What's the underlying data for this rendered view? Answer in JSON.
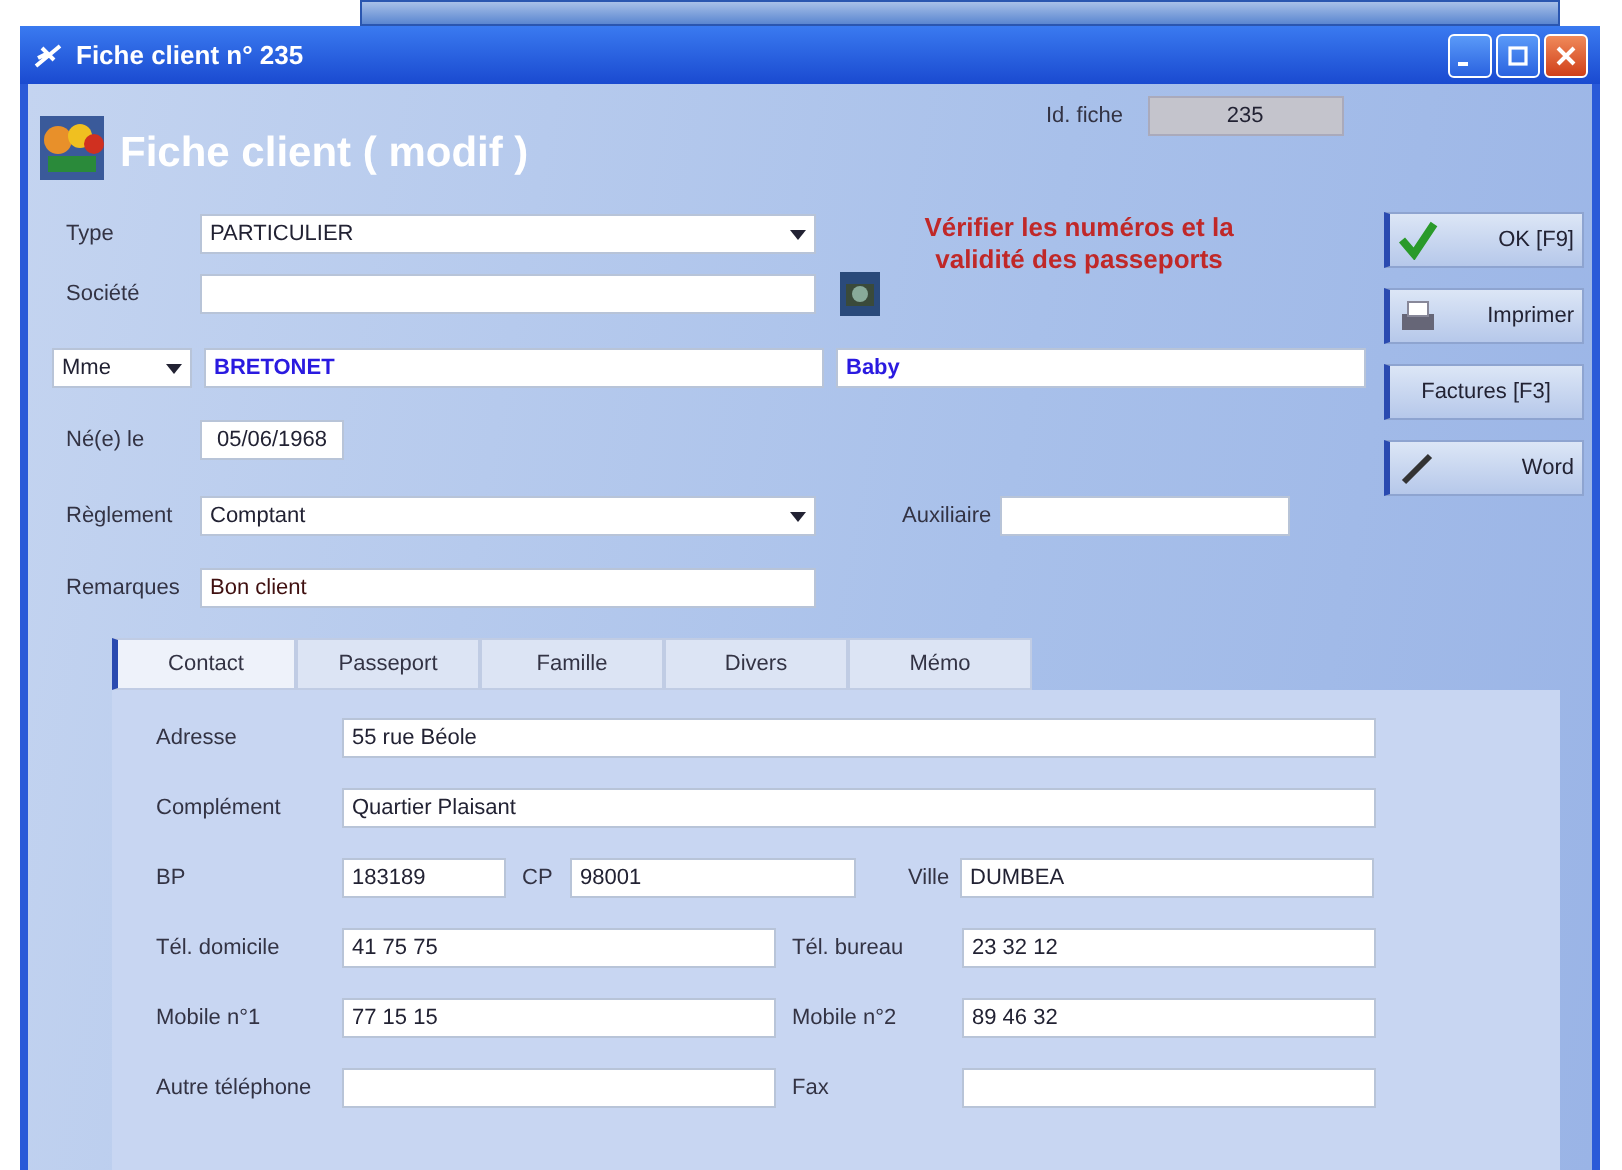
{
  "window": {
    "title": "Fiche client n° 235"
  },
  "header": {
    "title": "Fiche client ( modif )",
    "id_label": "Id. fiche",
    "id_value": "235"
  },
  "warning": "Vérifier les numéros et la validité des passeports",
  "form": {
    "type_label": "Type",
    "type_value": "PARTICULIER",
    "societe_label": "Société",
    "civilite": "Mme",
    "nom": "BRETONET",
    "prenom": "Baby",
    "naissance_label": "Né(e) le",
    "naissance": "05/06/1968",
    "reglement_label": "Règlement",
    "reglement": "Comptant",
    "auxiliaire_label": "Auxiliaire",
    "remarques_label": "Remarques",
    "remarques": "Bon client"
  },
  "buttons": [
    {
      "label": "OK [F9]"
    },
    {
      "label": "Imprimer"
    },
    {
      "label": "Factures [F3]"
    },
    {
      "label": "Word"
    }
  ],
  "tabs": [
    {
      "label": "Contact",
      "selected": true
    },
    {
      "label": "Passeport",
      "selected": false
    },
    {
      "label": "Famille",
      "selected": false
    },
    {
      "label": "Divers",
      "selected": false
    },
    {
      "label": "Mémo",
      "selected": false
    }
  ],
  "contact": [
    {
      "kind": "wide",
      "cells": [
        {
          "label": "Adresse",
          "value": "55 rue Béole"
        }
      ]
    },
    {
      "kind": "wide",
      "cells": [
        {
          "label": "Complément",
          "value": "Quartier Plaisant"
        }
      ]
    },
    {
      "kind": "triple",
      "cells": [
        {
          "label": "BP",
          "value": "183189"
        },
        {
          "label": "CP",
          "value": "98001"
        },
        {
          "label": "Ville",
          "value": "DUMBEA"
        }
      ]
    },
    {
      "kind": "pair",
      "cells": [
        {
          "label": "Tél. domicile",
          "value": "41 75 75"
        },
        {
          "label": "Tél. bureau",
          "value": "23 32 12"
        }
      ]
    },
    {
      "kind": "pair",
      "cells": [
        {
          "label": "Mobile n°1",
          "value": "77 15 15"
        },
        {
          "label": "Mobile n°2",
          "value": "89 46 32"
        }
      ]
    },
    {
      "kind": "pair",
      "cells": [
        {
          "label": "Autre téléphone"
        },
        {
          "label": "Fax"
        }
      ]
    }
  ]
}
